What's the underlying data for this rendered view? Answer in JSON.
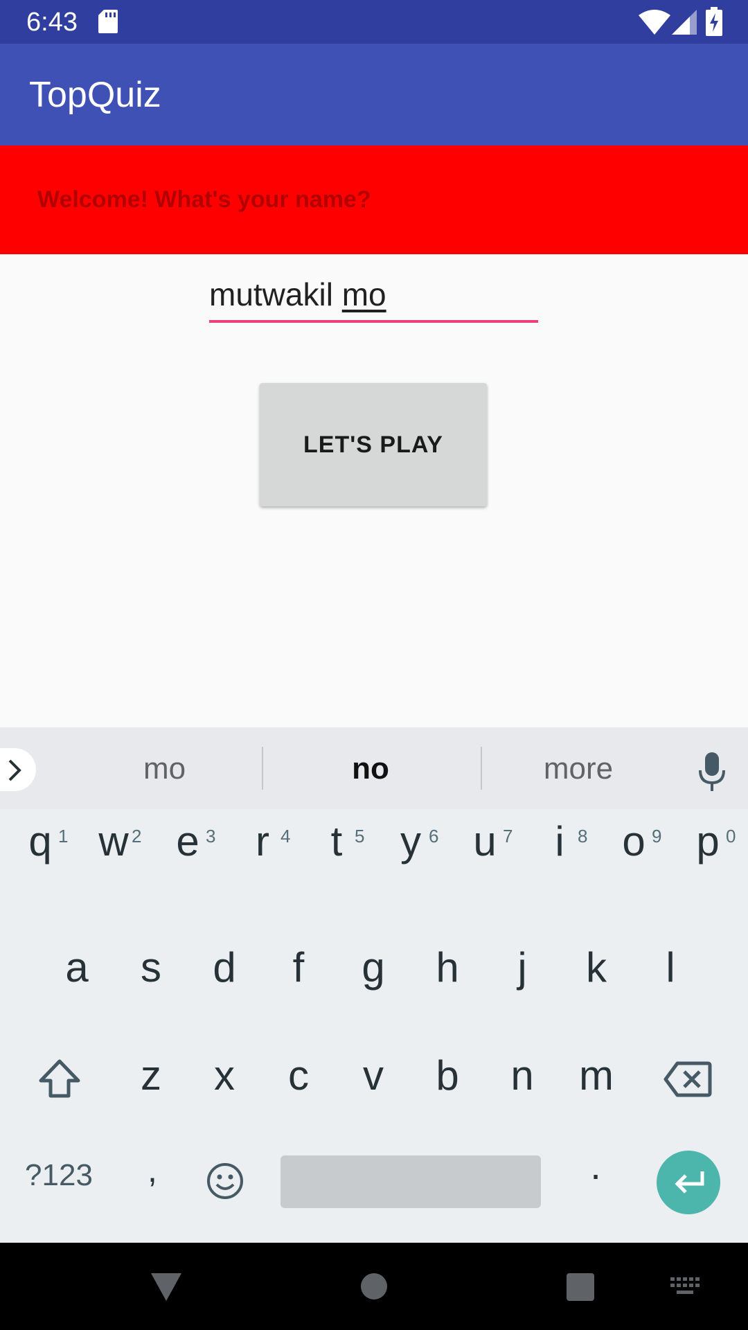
{
  "status_bar": {
    "time": "6:43",
    "icons": [
      "sd-card-icon",
      "wifi-icon",
      "signal-icon",
      "battery-charging-icon"
    ]
  },
  "app_bar": {
    "title": "TopQuiz"
  },
  "welcome": {
    "text": "Welcome! What's your name?"
  },
  "name_input": {
    "value_committed": "mutwakil ",
    "value_composing": "mo"
  },
  "play_button": {
    "label": "LET'S PLAY"
  },
  "keyboard": {
    "suggestions": [
      "mo",
      "no",
      "more"
    ],
    "row1": [
      {
        "key": "q",
        "hint": "1"
      },
      {
        "key": "w",
        "hint": "2"
      },
      {
        "key": "e",
        "hint": "3"
      },
      {
        "key": "r",
        "hint": "4"
      },
      {
        "key": "t",
        "hint": "5"
      },
      {
        "key": "y",
        "hint": "6"
      },
      {
        "key": "u",
        "hint": "7"
      },
      {
        "key": "i",
        "hint": "8"
      },
      {
        "key": "o",
        "hint": "9"
      },
      {
        "key": "p",
        "hint": "0"
      }
    ],
    "row2": [
      "a",
      "s",
      "d",
      "f",
      "g",
      "h",
      "j",
      "k",
      "l"
    ],
    "row3": [
      "z",
      "x",
      "c",
      "v",
      "b",
      "n",
      "m"
    ],
    "symbols_label": "?123",
    "comma_label": ",",
    "period_label": "."
  },
  "colors": {
    "status_bar": "#303f9f",
    "app_bar": "#3f51b5",
    "banner": "#ff0000",
    "input_underline": "#ec407a",
    "enter_key": "#4db6ac"
  }
}
